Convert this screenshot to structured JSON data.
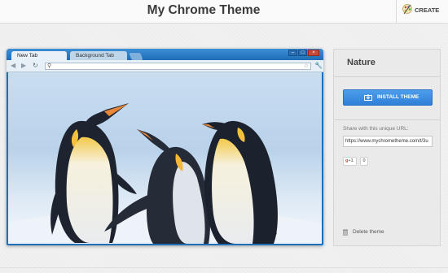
{
  "site": {
    "title": "My Chrome Theme",
    "create_label": "CREATE"
  },
  "browser_preview": {
    "tabs": [
      {
        "label": "New Tab",
        "active": true
      },
      {
        "label": "Background Tab",
        "active": false
      }
    ],
    "window_controls": [
      "minimize-icon",
      "maximize-icon",
      "close-icon"
    ],
    "nav_icons": [
      "back-icon",
      "forward-icon",
      "reload-icon"
    ],
    "omnibox_icons": [
      "search-icon",
      "star-icon"
    ],
    "menu_icon": "wrench-icon",
    "ntp_image": "penguins"
  },
  "sidebar": {
    "theme_name": "Nature",
    "install_label": "INSTALL THEME",
    "share_label": "Share with this unique URL:",
    "share_url": "https://www.mychrometheme.com/t/3u",
    "gplus_label": "+1",
    "gplus_count": "0",
    "delete_label": "Delete theme"
  },
  "colors": {
    "frame_blue": "#1c6fb8",
    "install_button": "#3a8ae0"
  }
}
